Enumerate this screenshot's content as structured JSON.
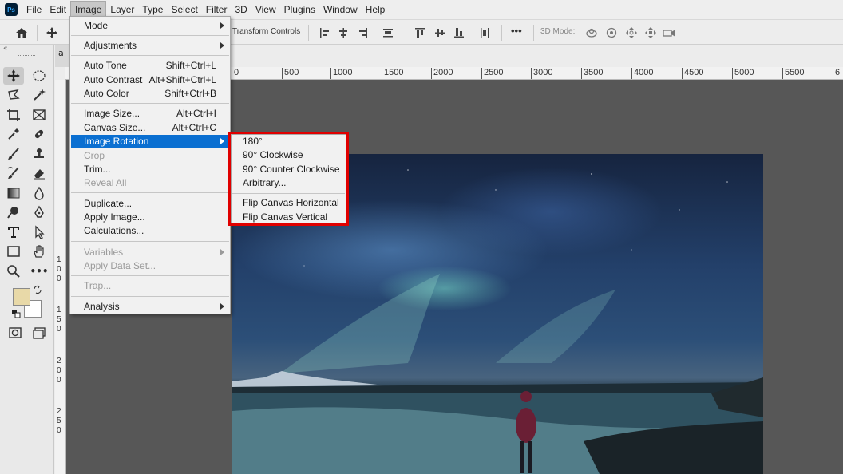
{
  "app": {
    "logo_text": "Ps"
  },
  "menubar": {
    "items": [
      "File",
      "Edit",
      "Image",
      "Layer",
      "Type",
      "Select",
      "Filter",
      "3D",
      "View",
      "Plugins",
      "Window",
      "Help"
    ],
    "active": "Image"
  },
  "optionsbar": {
    "transform_controls_label": "Transform Controls",
    "mode_label": "3D Mode:",
    "more_label": "•••"
  },
  "toolpanel": {
    "collapse_label": "«",
    "more_tools_label": "•••"
  },
  "document": {
    "tab_label": "a"
  },
  "ruler": {
    "top_ticks": [
      "0",
      "500",
      "1000",
      "1500",
      "2000",
      "2500",
      "3000",
      "3500",
      "4000",
      "4500",
      "5000",
      "5500",
      "6"
    ],
    "left_groups": [
      [
        "1",
        "0",
        "0"
      ],
      [
        "1",
        "5",
        "0"
      ],
      [
        "2",
        "0",
        "0"
      ],
      [
        "2",
        "5",
        "0"
      ]
    ]
  },
  "image_menu": {
    "mode": "Mode",
    "adjustments": "Adjustments",
    "auto_tone": {
      "label": "Auto Tone",
      "shortcut": "Shift+Ctrl+L"
    },
    "auto_contrast": {
      "label": "Auto Contrast",
      "shortcut": "Alt+Shift+Ctrl+L"
    },
    "auto_color": {
      "label": "Auto Color",
      "shortcut": "Shift+Ctrl+B"
    },
    "image_size": {
      "label": "Image Size...",
      "shortcut": "Alt+Ctrl+I"
    },
    "canvas_size": {
      "label": "Canvas Size...",
      "shortcut": "Alt+Ctrl+C"
    },
    "image_rotation": "Image Rotation",
    "crop": "Crop",
    "trim": "Trim...",
    "reveal_all": "Reveal All",
    "duplicate": "Duplicate...",
    "apply_image": "Apply Image...",
    "calculations": "Calculations...",
    "variables": "Variables",
    "apply_data_set": "Apply Data Set...",
    "trap": "Trap...",
    "analysis": "Analysis"
  },
  "rotation_submenu": {
    "r180": "180°",
    "cw90": "90° Clockwise",
    "ccw90": "90° Counter Clockwise",
    "arbitrary": "Arbitrary...",
    "flip_h": "Flip Canvas Horizontal",
    "flip_v": "Flip Canvas Vertical"
  },
  "colors": {
    "highlight": "#0a6fd1",
    "annotation_frame": "#e00000",
    "foreground_swatch": "#e8d9a8",
    "background_swatch": "#ffffff"
  }
}
